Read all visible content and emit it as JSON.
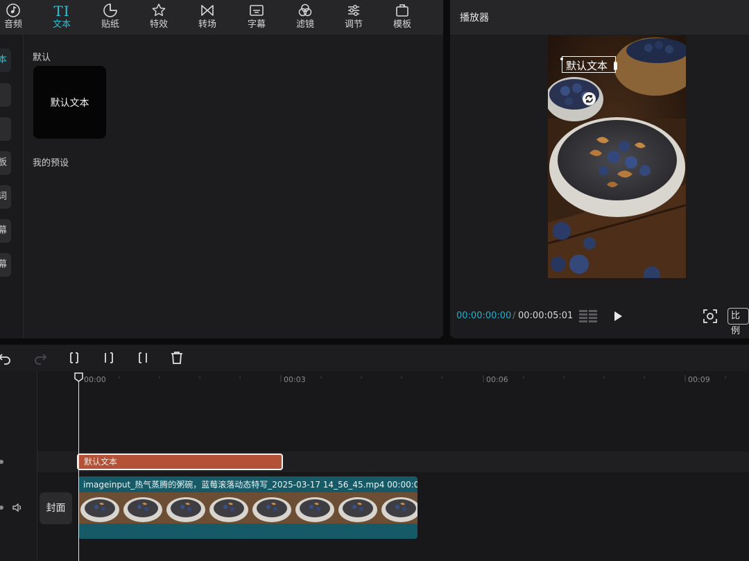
{
  "toolbar": {
    "items": [
      {
        "label": "音频",
        "icon": "music-note-icon"
      },
      {
        "label": "文本",
        "icon": "text-ti-icon",
        "glyph": "TI",
        "active": true
      },
      {
        "label": "贴纸",
        "icon": "sticker-icon"
      },
      {
        "label": "特效",
        "icon": "effects-star-icon"
      },
      {
        "label": "转场",
        "icon": "transition-bowtie-icon"
      },
      {
        "label": "字幕",
        "icon": "subtitle-icon"
      },
      {
        "label": "滤镜",
        "icon": "filter-circles-icon"
      },
      {
        "label": "调节",
        "icon": "adjust-sliders-icon"
      },
      {
        "label": "模板",
        "icon": "template-icon"
      }
    ]
  },
  "sidebar": {
    "tabs": [
      {
        "label": "本",
        "active": true
      },
      {
        "label": ""
      },
      {
        "label": ""
      },
      {
        "label": "板"
      },
      {
        "label": "词"
      },
      {
        "label": "幕"
      },
      {
        "label": "幕"
      }
    ]
  },
  "text_panel": {
    "default_section": "默认",
    "default_preset": "默认文本",
    "my_presets_section": "我的预设"
  },
  "player": {
    "title": "播放器",
    "overlay_text": "默认文本",
    "current_time": "00:00:00:00",
    "total_time": "00:00:05:01",
    "ratio_label": "比例"
  },
  "timeline": {
    "ruler_labels": [
      "00:00",
      "00:03",
      "00:06",
      "00:09"
    ],
    "text_clip_label": "默认文本",
    "video_clip_label": "imageinput_热气蒸腾的粥碗，蓝莓滚落动态特写_2025-03-17 14_56_45.mp4   00:00:0",
    "cover_label": "封面",
    "accent_color": "#23c3d8",
    "text_clip_color": "#b35236",
    "video_clip_color": "#155a66"
  }
}
